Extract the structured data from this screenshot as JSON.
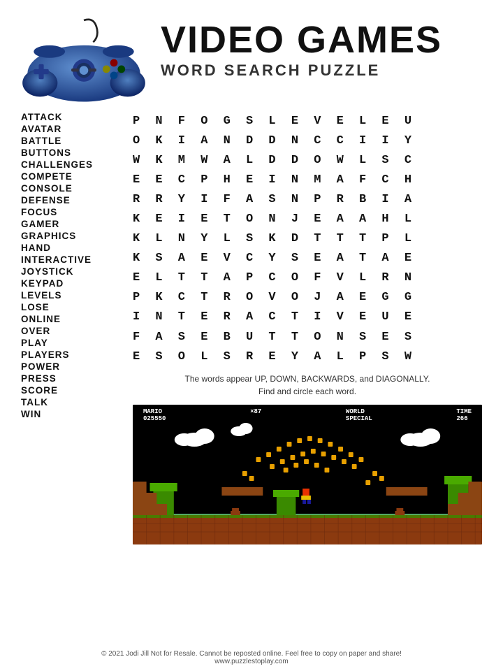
{
  "title": "VIDEO GAMES",
  "subtitle": "WORD SEARCH PUZZLE",
  "words": [
    "ATTACK",
    "AVATAR",
    "BATTLE",
    "BUTTONS",
    "CHALLENGES",
    "COMPETE",
    "CONSOLE",
    "DEFENSE",
    "FOCUS",
    "GAMER",
    "GRAPHICS",
    "HAND",
    "INTERACTIVE",
    "JOYSTICK",
    "KEYPAD",
    "LEVELS",
    "LOSE",
    "ONLINE",
    "OVER",
    "PLAY",
    "PLAYERS",
    "POWER",
    "PRESS",
    "SCORE",
    "TALK",
    "WIN"
  ],
  "grid": [
    "P N F O G S L E V E L E U",
    "O K I A N D D N C C I I Y",
    "W K M W A L D D O W L S C",
    "E E C P H E I N M A F C H",
    "R R Y I F A S N P R B I A",
    "K E I E T O N J E A A H L",
    "K L N Y L S K D T T T P L",
    "K S A E V C Y S E A T A E",
    "E L T T A P C O F V L R N",
    "P K C T R O V O J A E G G",
    "I N T E R A C T I V E U E",
    "F A S E B U T T O N S E S",
    "E S O L S R E Y A L P S W"
  ],
  "directions": "The words appear UP, DOWN, BACKWARDS, and DIAGONALLY.\nFind and circle each word.",
  "footer": "© 2021  Jodi Jill Not for Resale. Cannot be reposted online. Feel free to copy on paper and share!\nwww.puzzlestoplay.com",
  "hud": {
    "mario_label": "MARIO",
    "mario_score": "025550",
    "coin_count": "×87",
    "world_label": "WORLD",
    "world_value": "SPECIAL",
    "time_label": "TIME",
    "time_value": "266"
  }
}
